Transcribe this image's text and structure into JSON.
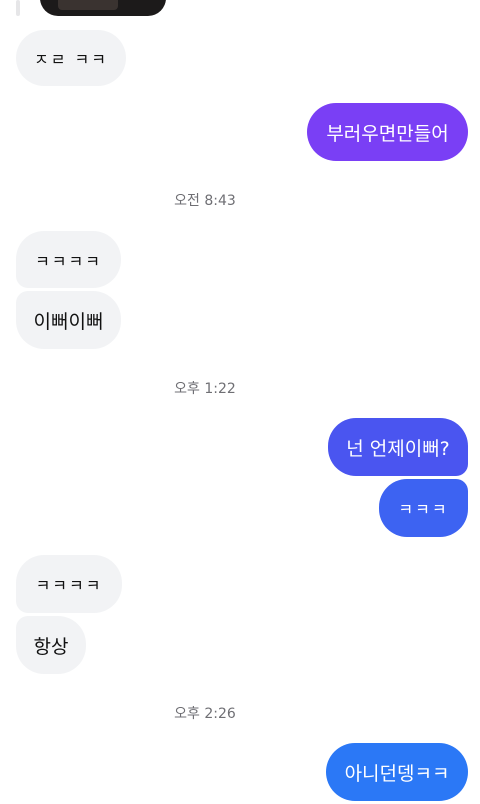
{
  "messages": [
    {
      "id": "m1",
      "side": "received",
      "text": "ㅈㄹ ㅋㅋ"
    },
    {
      "id": "m2",
      "side": "sent",
      "text": "부러우면만들어",
      "color": "#7a3ff5"
    },
    {
      "id": "t1",
      "type": "timestamp",
      "text": "오전 8:43"
    },
    {
      "id": "m3",
      "side": "received",
      "text": "ㅋㅋㅋㅋ"
    },
    {
      "id": "m4",
      "side": "received",
      "text": "이뻐이뻐"
    },
    {
      "id": "t2",
      "type": "timestamp",
      "text": "오후 1:22"
    },
    {
      "id": "m5",
      "side": "sent",
      "text": "넌 언제이뻐?",
      "color": "#4a55f0"
    },
    {
      "id": "m6",
      "side": "sent",
      "text": "ㅋㅋㅋ",
      "color": "#3d63f2"
    },
    {
      "id": "m7",
      "side": "received",
      "text": "ㅋㅋㅋㅋ"
    },
    {
      "id": "m8",
      "side": "received",
      "text": "항상"
    },
    {
      "id": "t3",
      "type": "timestamp",
      "text": "오후 2:26"
    },
    {
      "id": "m9",
      "side": "sent",
      "text": "아니던뎅ㅋㅋ",
      "color": "#2b78f6"
    }
  ],
  "colors": {
    "received_bubble": "#f2f3f5",
    "received_text": "#111111",
    "sent_text": "#ffffff",
    "timestamp_text": "#6f6f74"
  }
}
